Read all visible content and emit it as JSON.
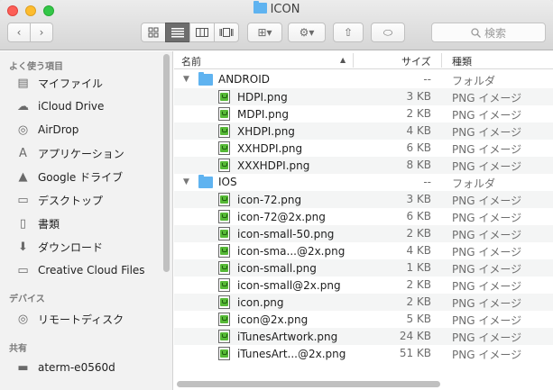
{
  "window": {
    "title": "ICON"
  },
  "toolbar": {
    "back": "‹",
    "forward": "›",
    "views": [
      "icon-view",
      "list-view",
      "column-view",
      "coverflow-view"
    ],
    "arrange": "⊞▾",
    "action": "⚙▾",
    "share": "⇧",
    "tag": "⬭",
    "search_placeholder": "検索"
  },
  "sidebar": {
    "favorites_heading": "よく使う項目",
    "favorites": [
      {
        "label": "マイファイル",
        "icon": "all-my-files-icon",
        "glyph": "▤"
      },
      {
        "label": "iCloud Drive",
        "icon": "cloud-icon",
        "glyph": "☁"
      },
      {
        "label": "AirDrop",
        "icon": "airdrop-icon",
        "glyph": "◎"
      },
      {
        "label": "アプリケーション",
        "icon": "applications-icon",
        "glyph": "A"
      },
      {
        "label": "Google ドライブ",
        "icon": "google-drive-icon",
        "glyph": "▲"
      },
      {
        "label": "デスクトップ",
        "icon": "desktop-icon",
        "glyph": "▭"
      },
      {
        "label": "書類",
        "icon": "documents-icon",
        "glyph": "▯"
      },
      {
        "label": "ダウンロード",
        "icon": "downloads-icon",
        "glyph": "⬇"
      },
      {
        "label": "Creative Cloud Files",
        "icon": "folder-icon",
        "glyph": "▭"
      }
    ],
    "devices_heading": "デバイス",
    "devices": [
      {
        "label": "リモートディスク",
        "icon": "remote-disc-icon",
        "glyph": "◎"
      }
    ],
    "shared_heading": "共有",
    "shared": [
      {
        "label": "aterm-e0560d",
        "icon": "network-computer-icon",
        "glyph": "▬"
      }
    ]
  },
  "columns": {
    "name": "名前",
    "size": "サイズ",
    "kind": "種類",
    "sort_indicator": "▲"
  },
  "rows": [
    {
      "type": "folder",
      "name": "ANDROID",
      "size": "--",
      "kind": "フォルダ",
      "level": 0,
      "expanded": true
    },
    {
      "type": "png",
      "name": "HDPI.png",
      "size": "3 KB",
      "kind": "PNG イメージ",
      "level": 1
    },
    {
      "type": "png",
      "name": "MDPI.png",
      "size": "2 KB",
      "kind": "PNG イメージ",
      "level": 1
    },
    {
      "type": "png",
      "name": "XHDPI.png",
      "size": "4 KB",
      "kind": "PNG イメージ",
      "level": 1
    },
    {
      "type": "png",
      "name": "XXHDPI.png",
      "size": "6 KB",
      "kind": "PNG イメージ",
      "level": 1
    },
    {
      "type": "png",
      "name": "XXXHDPI.png",
      "size": "8 KB",
      "kind": "PNG イメージ",
      "level": 1
    },
    {
      "type": "folder",
      "name": "IOS",
      "size": "--",
      "kind": "フォルダ",
      "level": 0,
      "expanded": true
    },
    {
      "type": "png",
      "name": "icon-72.png",
      "size": "3 KB",
      "kind": "PNG イメージ",
      "level": 1
    },
    {
      "type": "png",
      "name": "icon-72@2x.png",
      "size": "6 KB",
      "kind": "PNG イメージ",
      "level": 1
    },
    {
      "type": "png",
      "name": "icon-small-50.png",
      "size": "2 KB",
      "kind": "PNG イメージ",
      "level": 1
    },
    {
      "type": "png",
      "name": "icon-sma...@2x.png",
      "size": "4 KB",
      "kind": "PNG イメージ",
      "level": 1
    },
    {
      "type": "png",
      "name": "icon-small.png",
      "size": "1 KB",
      "kind": "PNG イメージ",
      "level": 1
    },
    {
      "type": "png",
      "name": "icon-small@2x.png",
      "size": "2 KB",
      "kind": "PNG イメージ",
      "level": 1
    },
    {
      "type": "png",
      "name": "icon.png",
      "size": "2 KB",
      "kind": "PNG イメージ",
      "level": 1
    },
    {
      "type": "png",
      "name": "icon@2x.png",
      "size": "5 KB",
      "kind": "PNG イメージ",
      "level": 1
    },
    {
      "type": "png",
      "name": "iTunesArtwork.png",
      "size": "24 KB",
      "kind": "PNG イメージ",
      "level": 1
    },
    {
      "type": "png",
      "name": "iTunesArt...@2x.png",
      "size": "51 KB",
      "kind": "PNG イメージ",
      "level": 1
    }
  ],
  "colors": {
    "folder": "#5fb3f0",
    "png_badge": "#56b936",
    "selected_view": "#6d6d6d"
  }
}
